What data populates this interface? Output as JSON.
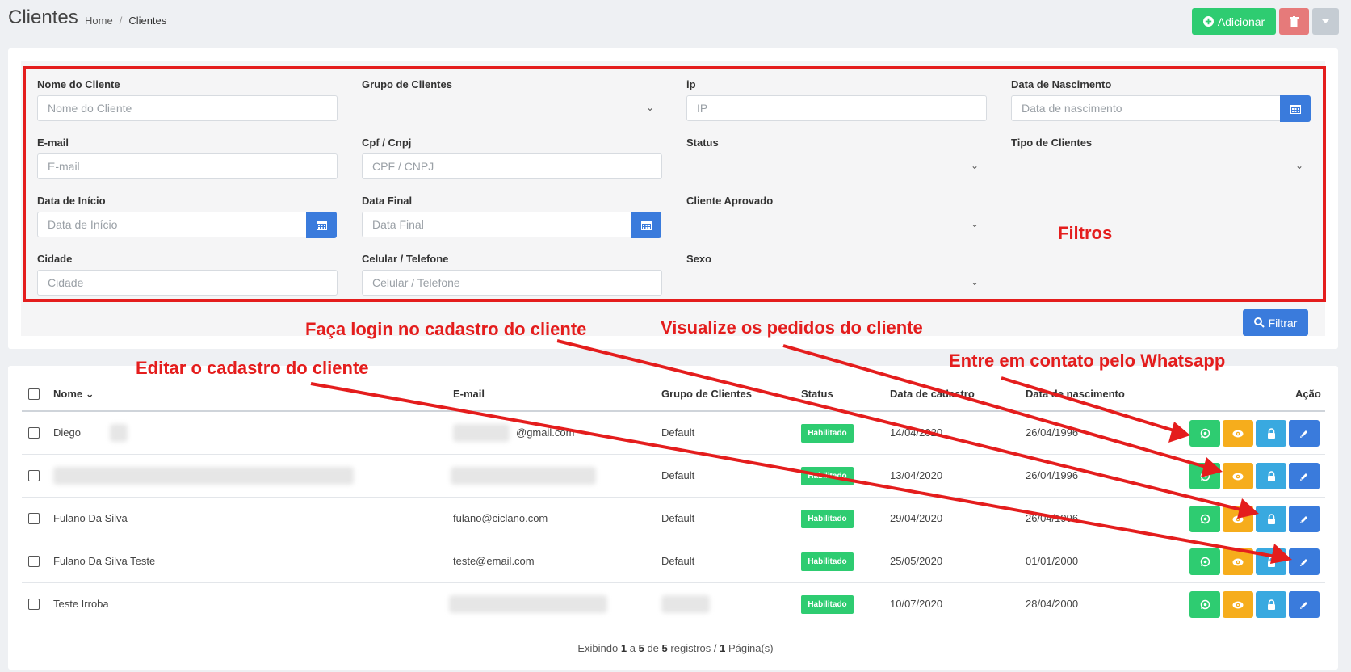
{
  "header": {
    "title": "Clientes",
    "breadcrumb": [
      "Home",
      "Clientes"
    ],
    "add_label": "Adicionar"
  },
  "filters": {
    "fields": [
      {
        "label": "Nome do Cliente",
        "placeholder": "Nome do Cliente"
      },
      {
        "label": "Grupo de Clientes"
      },
      {
        "label": "ip",
        "placeholder": "IP"
      },
      {
        "label": "Data de Nascimento",
        "placeholder": "Data de nascimento"
      },
      {
        "label": "E-mail",
        "placeholder": "E-mail"
      },
      {
        "label": "Cpf / Cnpj",
        "placeholder": "CPF / CNPJ"
      },
      {
        "label": "Status"
      },
      {
        "label": "Tipo de Clientes"
      },
      {
        "label": "Data de Início",
        "placeholder": "Data de Início"
      },
      {
        "label": "Data Final",
        "placeholder": "Data Final"
      },
      {
        "label": "Cliente Aprovado"
      },
      {
        "label": "Cidade",
        "placeholder": "Cidade"
      },
      {
        "label": "Celular / Telefone",
        "placeholder": "Celular / Telefone"
      },
      {
        "label": "Sexo"
      }
    ],
    "filter_button": "Filtrar"
  },
  "table": {
    "columns": [
      "Nome",
      "E-mail",
      "Grupo de Clientes",
      "Status",
      "Data de cadastro",
      "Data de nascimento",
      "Ação"
    ],
    "rows": [
      {
        "name": "Diego",
        "email": "@gmail.com",
        "group": "Default",
        "status": "Habilitado",
        "created": "14/04/2020",
        "birth": "26/04/1996"
      },
      {
        "name": "",
        "email": "",
        "group": "Default",
        "status": "Habilitado",
        "created": "13/04/2020",
        "birth": "26/04/1996"
      },
      {
        "name": "Fulano Da Silva",
        "email": "fulano@ciclano.com",
        "group": "Default",
        "status": "Habilitado",
        "created": "29/04/2020",
        "birth": "26/04/1996"
      },
      {
        "name": "Fulano Da Silva Teste",
        "email": "teste@email.com",
        "group": "Default",
        "status": "Habilitado",
        "created": "25/05/2020",
        "birth": "01/01/2000"
      },
      {
        "name": "Teste Irroba",
        "email": "",
        "group": "",
        "status": "Habilitado",
        "created": "10/07/2020",
        "birth": "28/04/2000"
      }
    ],
    "footer": {
      "prefix": "Exibindo",
      "from": "1",
      "a": "a",
      "to": "5",
      "de": "de",
      "total": "5",
      "registros": "registros /",
      "pages": "1",
      "pages_suffix": "Página(s)"
    }
  },
  "annotations": {
    "filters": "Filtros",
    "login": "Faça login no cadastro do cliente",
    "orders": "Visualize os pedidos do cliente",
    "whatsapp": "Entre em contato pelo Whatsapp",
    "edit": "Editar o cadastro do cliente"
  },
  "colors": {
    "success": "#2ecc71",
    "primary": "#3a7bdc",
    "warning": "#f6ad1c",
    "info": "#39a9e0",
    "annotation": "#e41d1d"
  }
}
